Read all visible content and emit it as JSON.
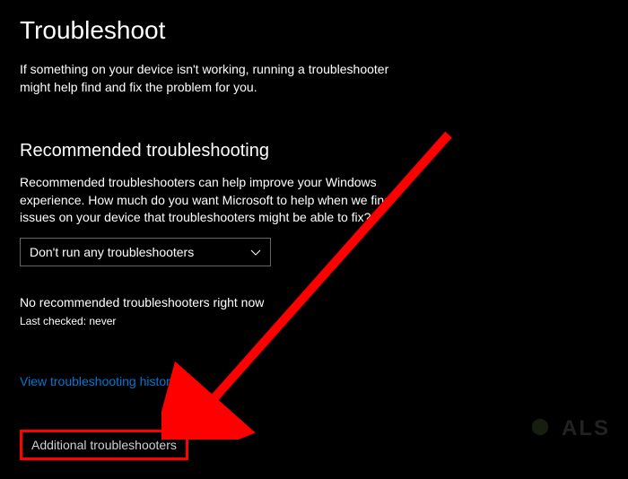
{
  "page": {
    "title": "Troubleshoot",
    "intro": "If something on your device isn't working, running a troubleshooter might help find and fix the problem for you."
  },
  "recommended": {
    "heading": "Recommended troubleshooting",
    "description": "Recommended troubleshooters can help improve your Windows experience. How much do you want Microsoft to help when we find issues on your device that troubleshooters might be able to fix?",
    "dropdown_selected": "Don't run any troubleshooters",
    "status": "No recommended troubleshooters right now",
    "last_checked": "Last checked: never"
  },
  "links": {
    "history": "View troubleshooting history",
    "additional": "Additional troubleshooters"
  },
  "watermark": {
    "text": "ALS"
  },
  "annotation": {
    "arrow_color": "#ff0000"
  }
}
